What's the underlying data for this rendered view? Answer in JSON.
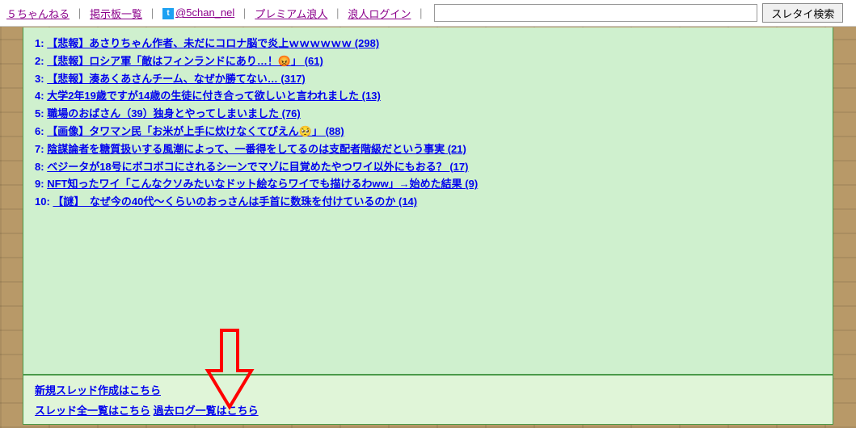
{
  "nav": {
    "home": "５ちゃんねる",
    "boards": "掲示板一覧",
    "twitter": "@5chan_nel",
    "premium": "プレミアム浪人",
    "ronin": "浪人ログイン",
    "search_placeholder": "",
    "search_button": "スレタイ検索"
  },
  "threads": [
    {
      "num": "1:",
      "title": "【悲報】あさりちゃん作者、未だにコロナ脳で炎上ｗｗｗｗｗｗ (298)"
    },
    {
      "num": "2:",
      "title": "【悲報】ロシア軍「敵はフィンランドにあり…！😡」 (61)"
    },
    {
      "num": "3:",
      "title": "【悲報】湊あくあさんチーム、なぜか勝てない… (317)"
    },
    {
      "num": "4:",
      "title": "大学2年19歳ですが14歳の生徒に付き合って欲しいと言われました (13)"
    },
    {
      "num": "5:",
      "title": "職場のおばさん（39）独身とやってしまいました (76)"
    },
    {
      "num": "6:",
      "title": "【画像】タワマン民「お米が上手に炊けなくてぴえん🥺」 (88)"
    },
    {
      "num": "7:",
      "title": "陰謀論者を糖質扱いする風潮によって、一番得をしてるのは支配者階級だという事実 (21)"
    },
    {
      "num": "8:",
      "title": "ベジータが18号にボコボコにされるシーンでマゾに目覚めたやつワイ以外にもおる？ (17)"
    },
    {
      "num": "9:",
      "title": "NFT知ったワイ「こんなクソみたいなドット絵ならワイでも描けるわww」→始めた結果 (9)"
    },
    {
      "num": "10:",
      "title": "【謎】　なぜ今の40代〜くらいのおっさんは手首に数珠を付けているのか (14)"
    }
  ],
  "bottom": {
    "new_thread": "新規スレッド作成はこちら",
    "all_threads": "スレッド全一覧はこちら",
    "past_log": "過去ログ一覧はこちら"
  }
}
